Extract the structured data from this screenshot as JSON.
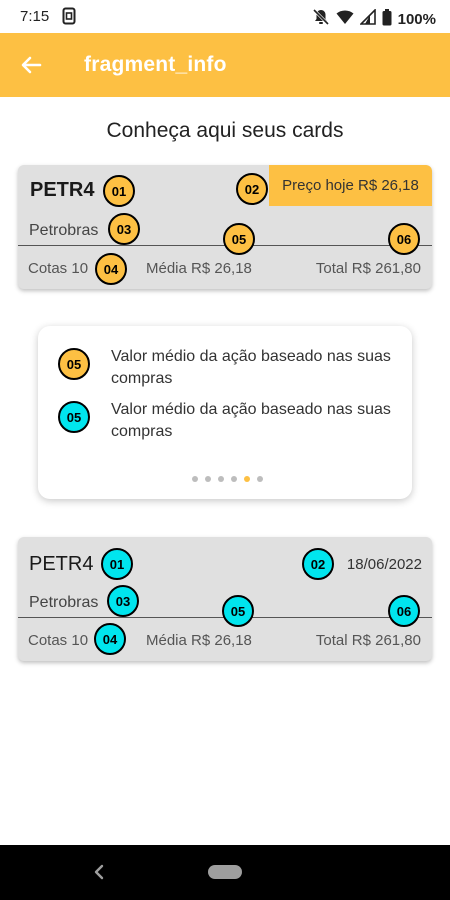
{
  "status_bar": {
    "time": "7:15",
    "battery": "100%",
    "icons": [
      "sim-icon",
      "mute-icon",
      "wifi-icon",
      "signal-icon",
      "battery-icon"
    ]
  },
  "app_bar": {
    "title": "fragment_info",
    "back_icon": "arrow-back-icon",
    "color": "#fdc043"
  },
  "heading": "Conheça aqui seus cards",
  "card_top": {
    "ticker": "PETR4",
    "price_badge": "Preço hoje R$ 26,18",
    "company": "Petrobras",
    "quotas": "Cotas 10",
    "average": "Média R$ 26,18",
    "total": "Total R$ 261,80",
    "markers": [
      "01",
      "02",
      "03",
      "04",
      "05",
      "06"
    ],
    "marker_color": "#fdc043"
  },
  "info": {
    "items": [
      {
        "marker": "05",
        "text": "Valor médio da ação baseado nas suas compras",
        "color": "#fdc043"
      },
      {
        "marker": "05",
        "text": "Valor médio da ação baseado nas suas compras",
        "color": "#00e5ee"
      }
    ],
    "pager": {
      "count": 6,
      "active_index": 4,
      "active_color": "#fdc043"
    }
  },
  "card_bottom": {
    "ticker": "PETR4",
    "date": "18/06/2022",
    "company": "Petrobras",
    "quotas": "Cotas 10",
    "average": "Média R$ 26,18",
    "total": "Total R$ 261,80",
    "markers": [
      "01",
      "02",
      "03",
      "04",
      "05",
      "06"
    ],
    "marker_color": "#00e5ee"
  },
  "nav_bar": {
    "icons": [
      "nav-back-icon",
      "home-pill-icon"
    ]
  }
}
